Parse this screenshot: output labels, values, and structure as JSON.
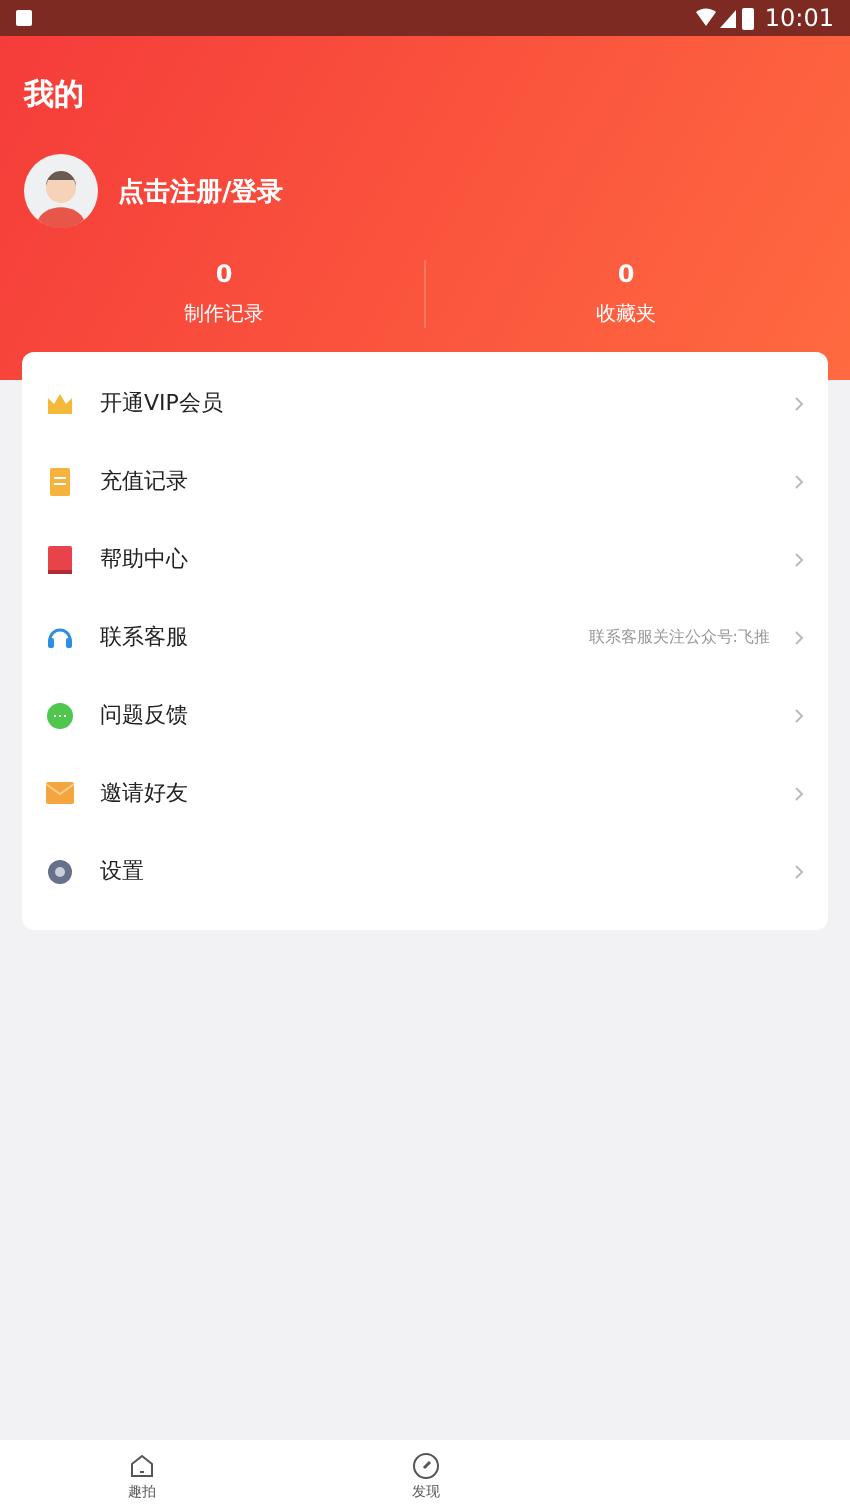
{
  "status_bar": {
    "time": "10:01"
  },
  "header": {
    "title": "我的",
    "login": "点击注册/登录"
  },
  "stats": [
    {
      "value": "0",
      "label": "制作记录"
    },
    {
      "value": "0",
      "label": "收藏夹"
    }
  ],
  "menu": [
    {
      "kind": "crown",
      "label": "开通VIP会员"
    },
    {
      "kind": "note",
      "label": "充值记录"
    },
    {
      "kind": "book",
      "label": "帮助中心"
    },
    {
      "kind": "headset",
      "label": "联系客服",
      "hint": "联系客服关注公众号:飞推"
    },
    {
      "kind": "chat",
      "label": "问题反馈"
    },
    {
      "kind": "mail",
      "label": "邀请好友"
    },
    {
      "kind": "gear",
      "label": "设置"
    }
  ],
  "tabs": [
    {
      "kind": "home",
      "label": "趣拍",
      "selected": false
    },
    {
      "kind": "compass",
      "label": "发现",
      "selected": false
    }
  ]
}
